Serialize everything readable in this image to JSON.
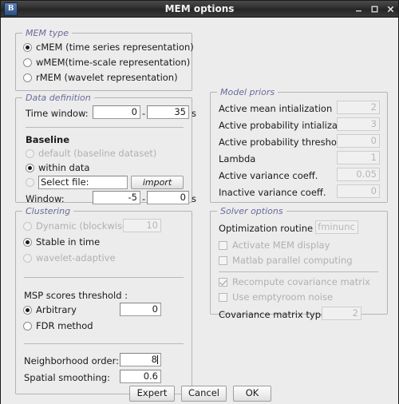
{
  "window": {
    "title": "MEM options",
    "app_icon": "brainstorm-icon",
    "controls": {
      "minimize": "minimize-icon",
      "maximize": "maximize-icon",
      "close": "close-icon"
    }
  },
  "mem_type": {
    "legend": "MEM type",
    "options": [
      {
        "label": "cMEM (time series representation)",
        "selected": true,
        "enabled": true
      },
      {
        "label": "wMEM(time-scale representation)",
        "selected": false,
        "enabled": true
      },
      {
        "label": "rMEM  (wavelet representation)",
        "selected": false,
        "enabled": true
      }
    ]
  },
  "data_definition": {
    "legend": "Data definition",
    "time_window_label": "Time window:",
    "time_window_start": "0",
    "time_window_end": "35",
    "time_window_unit": "s",
    "dash": "-",
    "baseline_label": "Baseline",
    "baseline_options": [
      {
        "label": "default (baseline dataset)",
        "selected": false,
        "enabled": false
      },
      {
        "label": "within data",
        "selected": true,
        "enabled": true
      }
    ],
    "select_file_label": "Select file:",
    "select_file_value": "",
    "import_label": "import",
    "window_label": "Window:",
    "window_start": "-5",
    "window_end": "0",
    "window_unit": "s"
  },
  "clustering": {
    "legend": "Clustering",
    "options": [
      {
        "label": "Dynamic (blockwise)",
        "selected": false,
        "enabled": false
      },
      {
        "label": "Stable in time",
        "selected": true,
        "enabled": true
      },
      {
        "label": "wavelet-adaptive",
        "selected": false,
        "enabled": false
      }
    ],
    "dynamic_value": "10",
    "msp_label": "MSP scores threshold :",
    "msp_options": [
      {
        "label": "Arbitrary",
        "selected": true,
        "enabled": true
      },
      {
        "label": "FDR method",
        "selected": false,
        "enabled": true
      }
    ],
    "arbitrary_value": "0",
    "neighborhood_order_label": "Neighborhood order:",
    "neighborhood_order_value": "8",
    "spatial_smoothing_label": "Spatial smoothing:",
    "spatial_smoothing_value": "0.6"
  },
  "model_priors": {
    "legend": "Model priors",
    "rows": [
      {
        "label": "Active mean intialization",
        "value": "2",
        "enabled": false
      },
      {
        "label": "Active probability intialization",
        "value": "3",
        "enabled": false
      },
      {
        "label": "Active probability threshold",
        "value": "0",
        "enabled": false
      },
      {
        "label": "Lambda",
        "value": "1",
        "enabled": false
      },
      {
        "label": "Active variance coeff.",
        "value": "0.05",
        "enabled": false
      },
      {
        "label": "Inactive variance coeff.",
        "value": "0",
        "enabled": false
      }
    ]
  },
  "solver_options": {
    "legend": "Solver options",
    "optimization_label": "Optimization routine",
    "optimization_value": "fminunc",
    "checkboxes": [
      {
        "label": "Activate MEM display",
        "checked": false,
        "enabled": false
      },
      {
        "label": "Matlab parallel computing",
        "checked": false,
        "enabled": false
      },
      {
        "label": "Recompute covariance matrix",
        "checked": true,
        "enabled": false
      },
      {
        "label": "Use emptyroom noise",
        "checked": false,
        "enabled": false
      }
    ],
    "covariance_label": "Covariance matrix type",
    "covariance_value": "2"
  },
  "footer": {
    "expert_label": "Expert",
    "cancel_label": "Cancel",
    "ok_label": "OK"
  }
}
